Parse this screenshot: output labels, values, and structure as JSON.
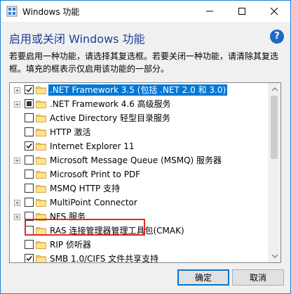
{
  "window": {
    "title": "Windows 功能"
  },
  "header": {
    "heading": "启用或关闭 Windows 功能",
    "description": "若要启用一种功能，请选择其复选框。若要关闭一种功能，请清除其复选框。填充的框表示仅启用该功能的一部分。"
  },
  "features": [
    {
      "label": ".NET Framework 3.5 (包括 .NET 2.0 和 3.0)",
      "expandable": true,
      "state": "checked",
      "selected": true
    },
    {
      "label": ".NET Framework 4.6 高级服务",
      "expandable": true,
      "state": "partial",
      "selected": false
    },
    {
      "label": "Active Directory 轻型目录服务",
      "expandable": false,
      "state": "unchecked",
      "selected": false
    },
    {
      "label": "HTTP 激活",
      "expandable": false,
      "state": "unchecked",
      "selected": false
    },
    {
      "label": "Internet Explorer 11",
      "expandable": false,
      "state": "checked",
      "selected": false
    },
    {
      "label": "Microsoft Message Queue (MSMQ) 服务器",
      "expandable": true,
      "state": "unchecked",
      "selected": false
    },
    {
      "label": "Microsoft Print to PDF",
      "expandable": false,
      "state": "unchecked",
      "selected": false
    },
    {
      "label": "MSMQ HTTP 支持",
      "expandable": false,
      "state": "unchecked",
      "selected": false
    },
    {
      "label": "MultiPoint Connector",
      "expandable": true,
      "state": "unchecked",
      "selected": false
    },
    {
      "label": "NFS 服务",
      "expandable": true,
      "state": "unchecked",
      "selected": false
    },
    {
      "label": "RAS 连接管理器管理工具包(CMAK)",
      "expandable": false,
      "state": "unchecked",
      "selected": false
    },
    {
      "label": "RIP 侦听器",
      "expandable": false,
      "state": "unchecked",
      "selected": false
    },
    {
      "label": "SMB 1.0/CIFS 文件共享支持",
      "expandable": false,
      "state": "checked",
      "selected": false
    }
  ],
  "buttons": {
    "ok": "确定",
    "cancel": "取消"
  },
  "colors": {
    "accent": "#0078d7",
    "heading": "#1e3f9b",
    "annotation": "#e02b2b"
  }
}
